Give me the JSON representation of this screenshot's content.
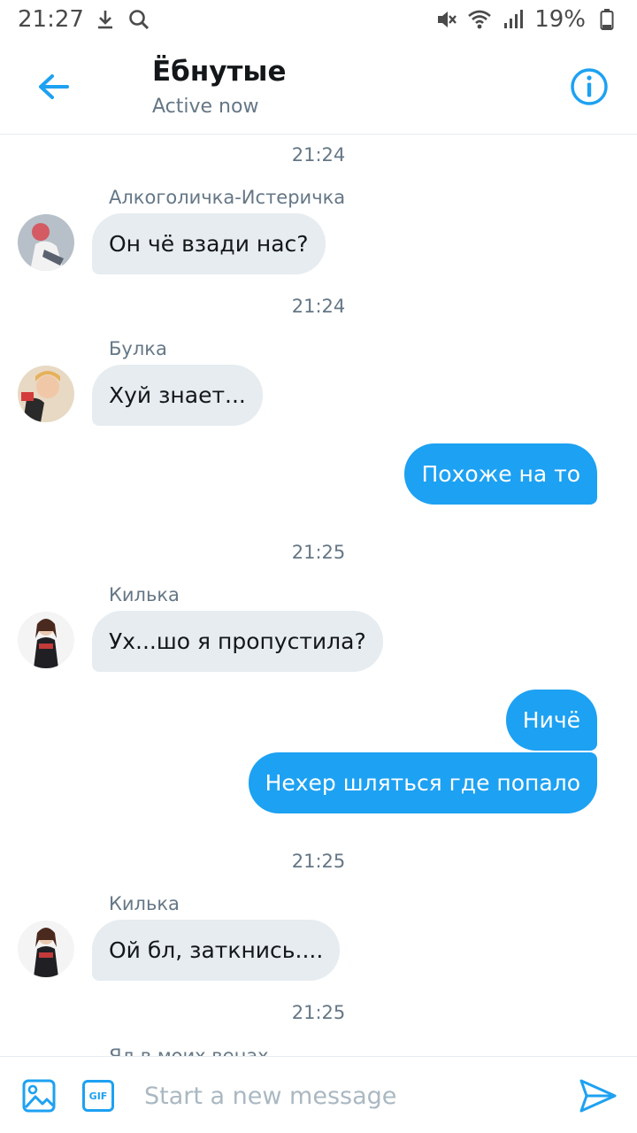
{
  "status_bar": {
    "time": "21:27",
    "battery": "19%"
  },
  "header": {
    "title": "Ёбнутые",
    "status": "Active now"
  },
  "messages": {
    "ts1": "21:24",
    "s1": "Алкоголичка-Истеричка",
    "m1": "Он чё взади нас?",
    "ts2": "21:24",
    "s2": "Булка",
    "m2": "Хуй знает...",
    "o1": "Похоже на то",
    "ts3": "21:25",
    "s3": "Килька",
    "m3": "Ух...шо я пропустила?",
    "o2": "Ничё",
    "o3": "Нехер шляться где попало",
    "ts4": "21:25",
    "s4": "Килька",
    "m4": "Ой бл, заткнись....",
    "ts5": "21:25",
    "s5": "Яд в моих венах"
  },
  "composer": {
    "placeholder": "Start a new message",
    "gif_label": "GIF"
  },
  "colors": {
    "accent": "#1da1f2",
    "incoming_bubble": "#e6ecf0",
    "secondary_text": "#657786"
  },
  "icons": [
    "download-icon",
    "search-icon",
    "mute-icon",
    "wifi-icon",
    "signal-icon",
    "battery-icon",
    "back-arrow-icon",
    "info-icon",
    "image-icon",
    "gif-icon",
    "send-icon"
  ]
}
